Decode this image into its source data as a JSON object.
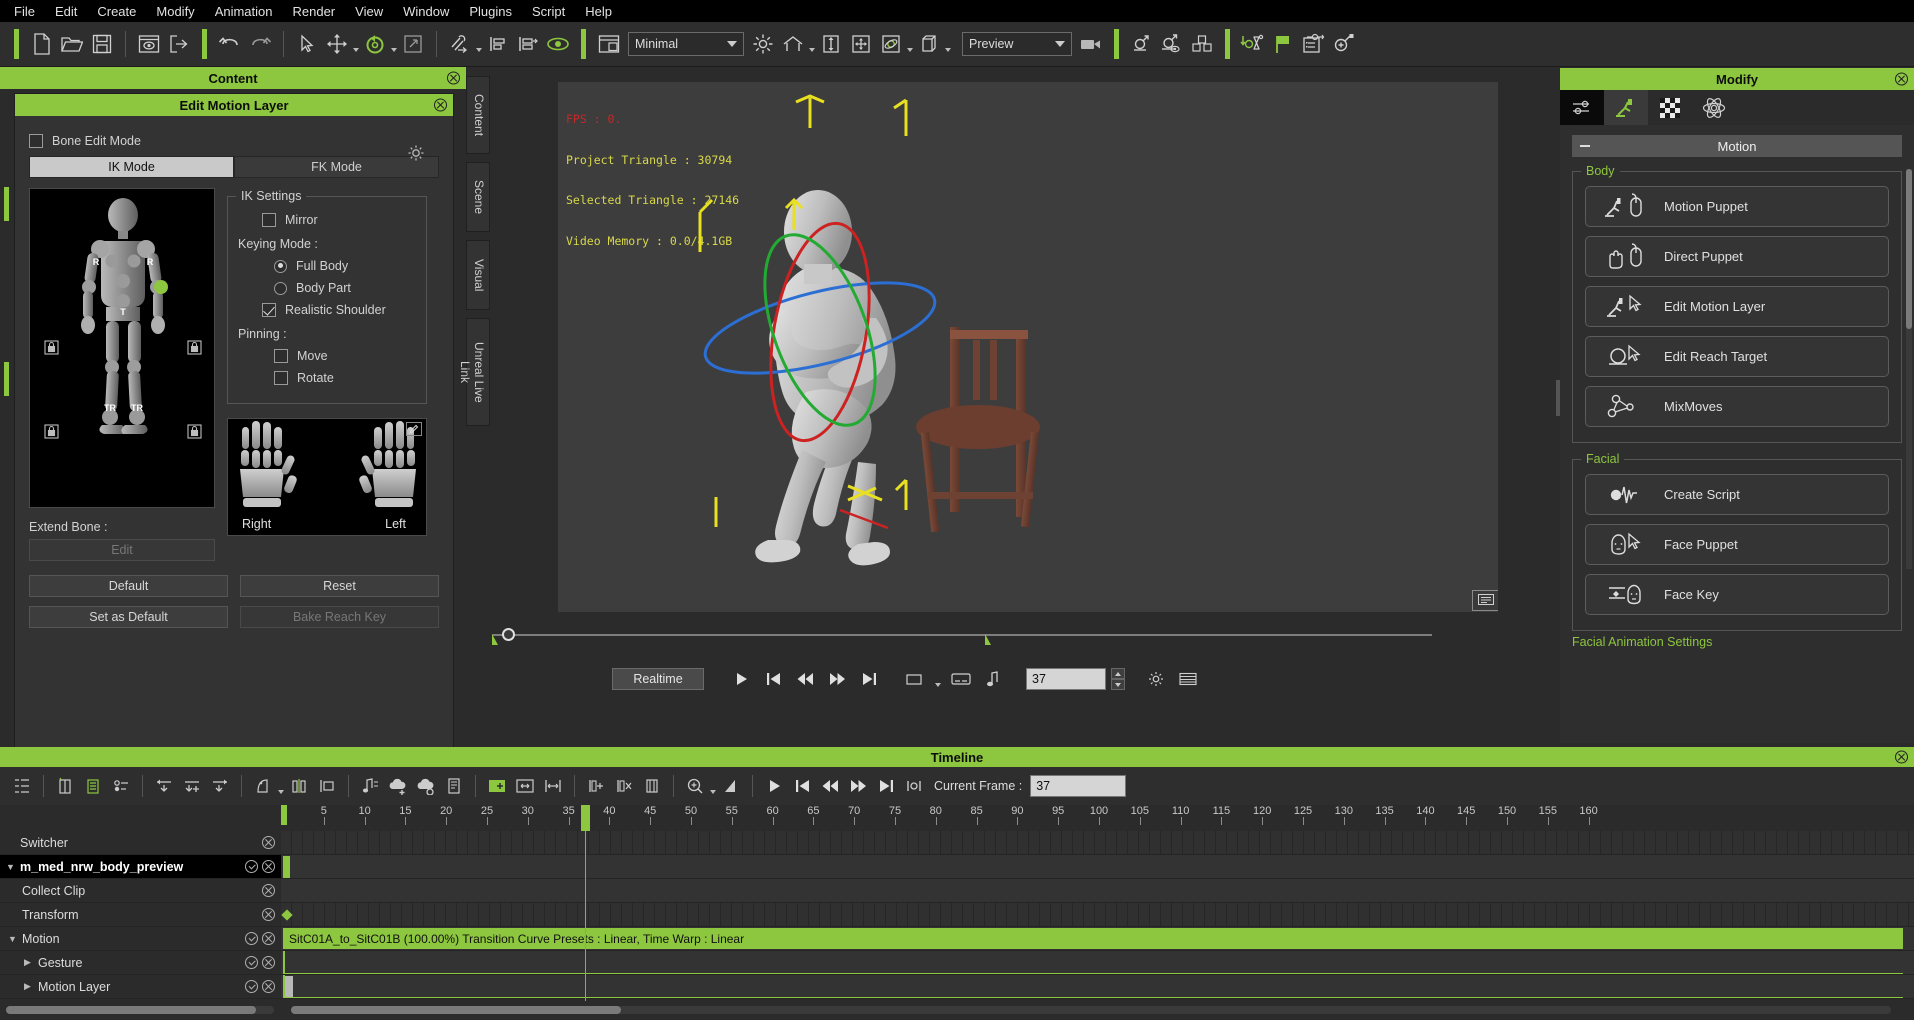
{
  "menu": {
    "items": [
      "File",
      "Edit",
      "Create",
      "Modify",
      "Animation",
      "Render",
      "View",
      "Window",
      "Plugins",
      "Script",
      "Help"
    ]
  },
  "toolbar": {
    "groups": [
      {
        "icons": [
          {
            "name": "new-file-icon"
          },
          {
            "name": "open-folder-icon"
          },
          {
            "name": "save-icon"
          }
        ]
      },
      {
        "icons": [
          {
            "name": "preview-window-icon"
          },
          {
            "name": "export-icon"
          }
        ]
      },
      {
        "icons": [
          {
            "name": "undo-icon"
          },
          {
            "name": "redo-icon"
          }
        ]
      },
      {
        "icons": [
          {
            "name": "select-arrow-icon"
          },
          {
            "name": "move-tool-icon",
            "caret": true
          },
          {
            "name": "rotate-tool-icon",
            "caret": true
          },
          {
            "name": "scale-tool-icon"
          }
        ]
      },
      {
        "icons": [
          {
            "name": "link-tool-icon",
            "caret": true
          },
          {
            "name": "align-left-icon"
          },
          {
            "name": "align-right-icon"
          },
          {
            "name": "eye-visibility-icon"
          }
        ]
      },
      {
        "icons": [
          {
            "name": "layout-window-icon"
          }
        ]
      }
    ],
    "layout_combo": {
      "value": "Minimal",
      "name": "layout-select"
    },
    "right_icons": [
      {
        "name": "light-sun-icon"
      },
      {
        "name": "home-view-icon",
        "caret": true
      },
      {
        "name": "vertical-fit-icon"
      },
      {
        "name": "move-view-icon"
      },
      {
        "name": "orbit-icon",
        "caret": true
      },
      {
        "name": "box-wireframe-icon",
        "caret": true
      }
    ],
    "render_combo": {
      "value": "Preview",
      "name": "render-mode-select"
    },
    "camera_icon": {
      "name": "camera-icon"
    },
    "tail_icons": [
      {
        "name": "character-icon"
      },
      {
        "name": "character-eye-icon"
      },
      {
        "name": "props-cubes-icon"
      },
      {
        "name": "motion-import-icon"
      },
      {
        "name": "flag-icon"
      },
      {
        "name": "task-list-icon"
      },
      {
        "name": "add-plugin-icon"
      }
    ]
  },
  "left_panel": {
    "content_tab": "Content",
    "vtabs": [
      "Content",
      "Scene",
      "Visual",
      "Unreal Live Link"
    ],
    "edit_motion_layer": {
      "title": "Edit Motion Layer",
      "bone_edit_mode": {
        "label": "Bone Edit Mode",
        "checked": false
      },
      "gear_icon": "settings-gear-icon",
      "mode_tabs": [
        {
          "label": "IK Mode",
          "active": true
        },
        {
          "label": "FK Mode",
          "active": false
        }
      ],
      "ik_settings": {
        "legend": "IK Settings",
        "mirror": {
          "label": "Mirror",
          "checked": false
        },
        "keying_mode_label": "Keying Mode :",
        "keying_options": [
          {
            "label": "Full Body",
            "selected": true
          },
          {
            "label": "Body Part",
            "selected": false
          }
        ],
        "realistic_shoulder": {
          "label": "Realistic Shoulder",
          "checked": true
        },
        "pinning_label": "Pinning :",
        "pinning": [
          {
            "label": "Move",
            "checked": false
          },
          {
            "label": "Rotate",
            "checked": false
          }
        ]
      },
      "puppet_labels": {
        "r_left": "R",
        "r_right": "R",
        "t": "T",
        "tr_left": "TR",
        "tr_right": "TR"
      },
      "hands": {
        "right": "Right",
        "left": "Left",
        "edit_icon": "pencil-edit-icon"
      },
      "extend_bone_label": "Extend Bone :",
      "extend_bone_button": {
        "label": "Edit",
        "disabled": true
      },
      "buttons": [
        {
          "label": "Default",
          "disabled": false
        },
        {
          "label": "Reset",
          "disabled": false
        },
        {
          "label": "Set as Default",
          "disabled": false
        },
        {
          "label": "Bake Reach Key",
          "disabled": true
        }
      ]
    }
  },
  "viewport": {
    "stats": {
      "fps": "FPS : 0.",
      "project_triangle": "Project Triangle : 30794",
      "selected_triangle": "Selected Triangle : 27146",
      "video_memory": "Video Memory : 0.0/4.1GB"
    },
    "note_icon": "comment-note-icon",
    "controls": {
      "realtime_label": "Realtime",
      "buttons": [
        {
          "name": "play-button",
          "glyph": "play"
        },
        {
          "name": "jump-to-start-button",
          "glyph": "skip-start"
        },
        {
          "name": "step-back-button",
          "glyph": "rewind"
        },
        {
          "name": "step-forward-button",
          "glyph": "fast-forward"
        },
        {
          "name": "jump-to-end-button",
          "glyph": "skip-end"
        },
        {
          "name": "screen-ratio-button",
          "glyph": "rect"
        },
        {
          "name": "subtitle-button",
          "glyph": "caption"
        },
        {
          "name": "audio-note-button",
          "glyph": "note"
        }
      ],
      "frame_value": "37",
      "settings_icon": "gear-icon",
      "list-icon": "list-view-icon"
    }
  },
  "right_panel": {
    "title": "Modify",
    "tabs": [
      {
        "name": "attribute-sliders-icon",
        "active": false,
        "dark": true
      },
      {
        "name": "animation-run-icon",
        "active": true
      },
      {
        "name": "checker-texture-icon",
        "active": false
      },
      {
        "name": "physics-atom-icon",
        "active": false
      }
    ],
    "section": {
      "label": "Motion",
      "collapsed": false
    },
    "body_group": {
      "legend": "Body",
      "items": [
        {
          "label": "Motion Puppet",
          "icon": "motion-puppet-icon"
        },
        {
          "label": "Direct Puppet",
          "icon": "direct-puppet-icon"
        },
        {
          "label": "Edit Motion Layer",
          "icon": "edit-motion-layer-icon"
        },
        {
          "label": "Edit Reach Target",
          "icon": "edit-reach-target-icon"
        },
        {
          "label": "MixMoves",
          "icon": "mixmoves-icon"
        }
      ]
    },
    "facial_group": {
      "legend": "Facial",
      "items": [
        {
          "label": "Create Script",
          "icon": "create-script-icon"
        },
        {
          "label": "Face Puppet",
          "icon": "face-puppet-icon"
        },
        {
          "label": "Face Key",
          "icon": "face-key-icon"
        }
      ]
    },
    "footer_label": "Facial Animation Settings"
  },
  "timeline": {
    "title": "Timeline",
    "toolbar_icons": [
      {
        "name": "track-list-icon"
      },
      {
        "name": "add-clip-icon"
      },
      {
        "name": "add-track-icon"
      },
      {
        "name": "key-options-icon"
      },
      {
        "name": "move-key-left-icon"
      },
      {
        "name": "add-key-icon"
      },
      {
        "name": "move-key-right-icon"
      },
      {
        "name": "transition-curve-icon",
        "caret": true
      },
      {
        "name": "split-clip-icon"
      },
      {
        "name": "align-clip-icon"
      },
      {
        "name": "audio-key-icon"
      },
      {
        "name": "cloud-add-icon"
      },
      {
        "name": "cloud-remove-icon"
      },
      {
        "name": "document-clip-icon"
      },
      {
        "name": "insert-frame-icon"
      },
      {
        "name": "stretch-clip-icon"
      },
      {
        "name": "fit-range-icon"
      },
      {
        "name": "add-frame-icon"
      },
      {
        "name": "delete-frame-icon"
      },
      {
        "name": "clip-props-icon"
      },
      {
        "name": "zoom-icon",
        "caret": true
      },
      {
        "name": "zoom-fit-icon"
      }
    ],
    "transport": [
      {
        "name": "play-button",
        "glyph": "play"
      },
      {
        "name": "jump-to-start-button",
        "glyph": "skip-start"
      },
      {
        "name": "step-back-button",
        "glyph": "rewind"
      },
      {
        "name": "step-forward-button",
        "glyph": "fast-forward"
      },
      {
        "name": "jump-to-end-button",
        "glyph": "skip-end"
      },
      {
        "name": "loop-range-button",
        "glyph": "loop"
      }
    ],
    "current_frame_label": "Current Frame :",
    "current_frame_value": "37",
    "ruler": {
      "ticks": [
        5,
        10,
        15,
        20,
        25,
        30,
        35,
        40,
        45,
        50,
        55,
        60,
        65,
        70,
        75,
        80,
        85,
        90,
        95,
        100,
        105,
        110,
        115,
        120,
        125,
        130,
        135,
        140,
        145,
        150,
        155,
        160
      ],
      "playhead_frame": 37,
      "pixels_per_frame": 8.16
    },
    "tracks": [
      {
        "label": "Switcher",
        "indent": 0,
        "selected": false,
        "expandable": false,
        "icons": [
          "x"
        ]
      },
      {
        "label": "m_med_nrw_body_preview",
        "indent": 0,
        "selected": true,
        "expandable": true,
        "expanded": true,
        "icons": [
          "v",
          "x"
        ]
      },
      {
        "label": "Collect Clip",
        "indent": 1,
        "selected": false,
        "expandable": false,
        "icons": [
          "x"
        ]
      },
      {
        "label": "Transform",
        "indent": 1,
        "selected": false,
        "expandable": false,
        "icons": [
          "x"
        ]
      },
      {
        "label": "Motion",
        "indent": 1,
        "selected": false,
        "expandable": true,
        "expanded": true,
        "icons": [
          "v",
          "x"
        ]
      },
      {
        "label": "Gesture",
        "indent": 2,
        "selected": false,
        "expandable": true,
        "expanded": false,
        "icons": [
          "v",
          "x"
        ]
      },
      {
        "label": "Motion Layer",
        "indent": 2,
        "selected": false,
        "expandable": true,
        "expanded": false,
        "icons": [
          "v",
          "x"
        ]
      }
    ],
    "motion_clip": {
      "label": "SitC01A_to_SitC01B (100.00%) Transition Curve Presets : Linear, Time Warp : Linear",
      "color": "#8dc63f"
    }
  },
  "colors": {
    "accent": "#8dc63f",
    "panel_bg": "#2b2b2b",
    "panel_mid": "#333333",
    "text": "#d6d6d6"
  }
}
